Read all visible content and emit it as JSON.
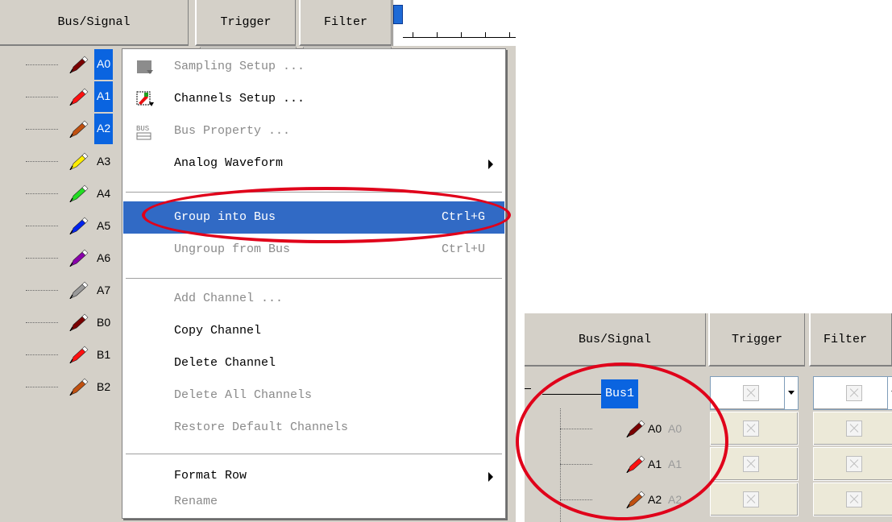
{
  "left_panel": {
    "headers": {
      "bus_signal": "Bus/Signal",
      "trigger": "Trigger",
      "filter": "Filter"
    },
    "signals": [
      {
        "label": "A0",
        "color": "#7a0000",
        "selected": true
      },
      {
        "label": "A1",
        "color": "#ff1010",
        "selected": true
      },
      {
        "label": "A2",
        "color": "#c05010",
        "selected": true
      },
      {
        "label": "A3",
        "color": "#ffee00",
        "selected": false
      },
      {
        "label": "A4",
        "color": "#22dd22",
        "selected": false
      },
      {
        "label": "A5",
        "color": "#0022ee",
        "selected": false
      },
      {
        "label": "A6",
        "color": "#8800aa",
        "selected": false
      },
      {
        "label": "A7",
        "color": "#9a9a9a",
        "selected": false
      },
      {
        "label": "B0",
        "color": "#7a0000",
        "selected": false
      },
      {
        "label": "B1",
        "color": "#ff1010",
        "selected": false
      },
      {
        "label": "B2",
        "color": "#c05010",
        "selected": false
      }
    ]
  },
  "context_menu": {
    "items": [
      {
        "label": "Sampling Setup ...",
        "icon": "sampling-setup-icon",
        "disabled": true
      },
      {
        "label": "Channels Setup ...",
        "icon": "channels-setup-icon",
        "disabled": false
      },
      {
        "label": "Bus Property ...",
        "icon": "bus-property-icon",
        "disabled": true
      },
      {
        "label": "Analog Waveform",
        "submenu": true,
        "disabled": false
      },
      {
        "label": "Group into Bus",
        "shortcut": "Ctrl+G",
        "disabled": false,
        "highlighted": true
      },
      {
        "label": "Ungroup from Bus",
        "shortcut": "Ctrl+U",
        "disabled": true
      },
      {
        "label": "Add Channel ...",
        "disabled": true
      },
      {
        "label": "Copy Channel",
        "disabled": false
      },
      {
        "label": "Delete Channel",
        "disabled": false
      },
      {
        "label": "Delete All Channels",
        "disabled": true
      },
      {
        "label": "Restore Default Channels",
        "disabled": true
      },
      {
        "label": "Format Row",
        "submenu": true,
        "disabled": false
      },
      {
        "label": "Rename",
        "disabled": true
      }
    ],
    "icon_texts": {
      "bus_property": "BUS"
    }
  },
  "right_panel": {
    "headers": {
      "bus_signal": "Bus/Signal",
      "trigger": "Trigger",
      "filter": "Filter"
    },
    "bus_name": "Bus1",
    "signals": [
      {
        "label": "A0",
        "ghost": "A0",
        "color": "#7a0000"
      },
      {
        "label": "A1",
        "ghost": "A1",
        "color": "#ff1010"
      },
      {
        "label": "A2",
        "ghost": "A2",
        "color": "#c05010"
      }
    ]
  },
  "colors": {
    "selection": "#0a64e0",
    "menu_highlight": "#316ac5",
    "annotation": "#e0001a"
  }
}
